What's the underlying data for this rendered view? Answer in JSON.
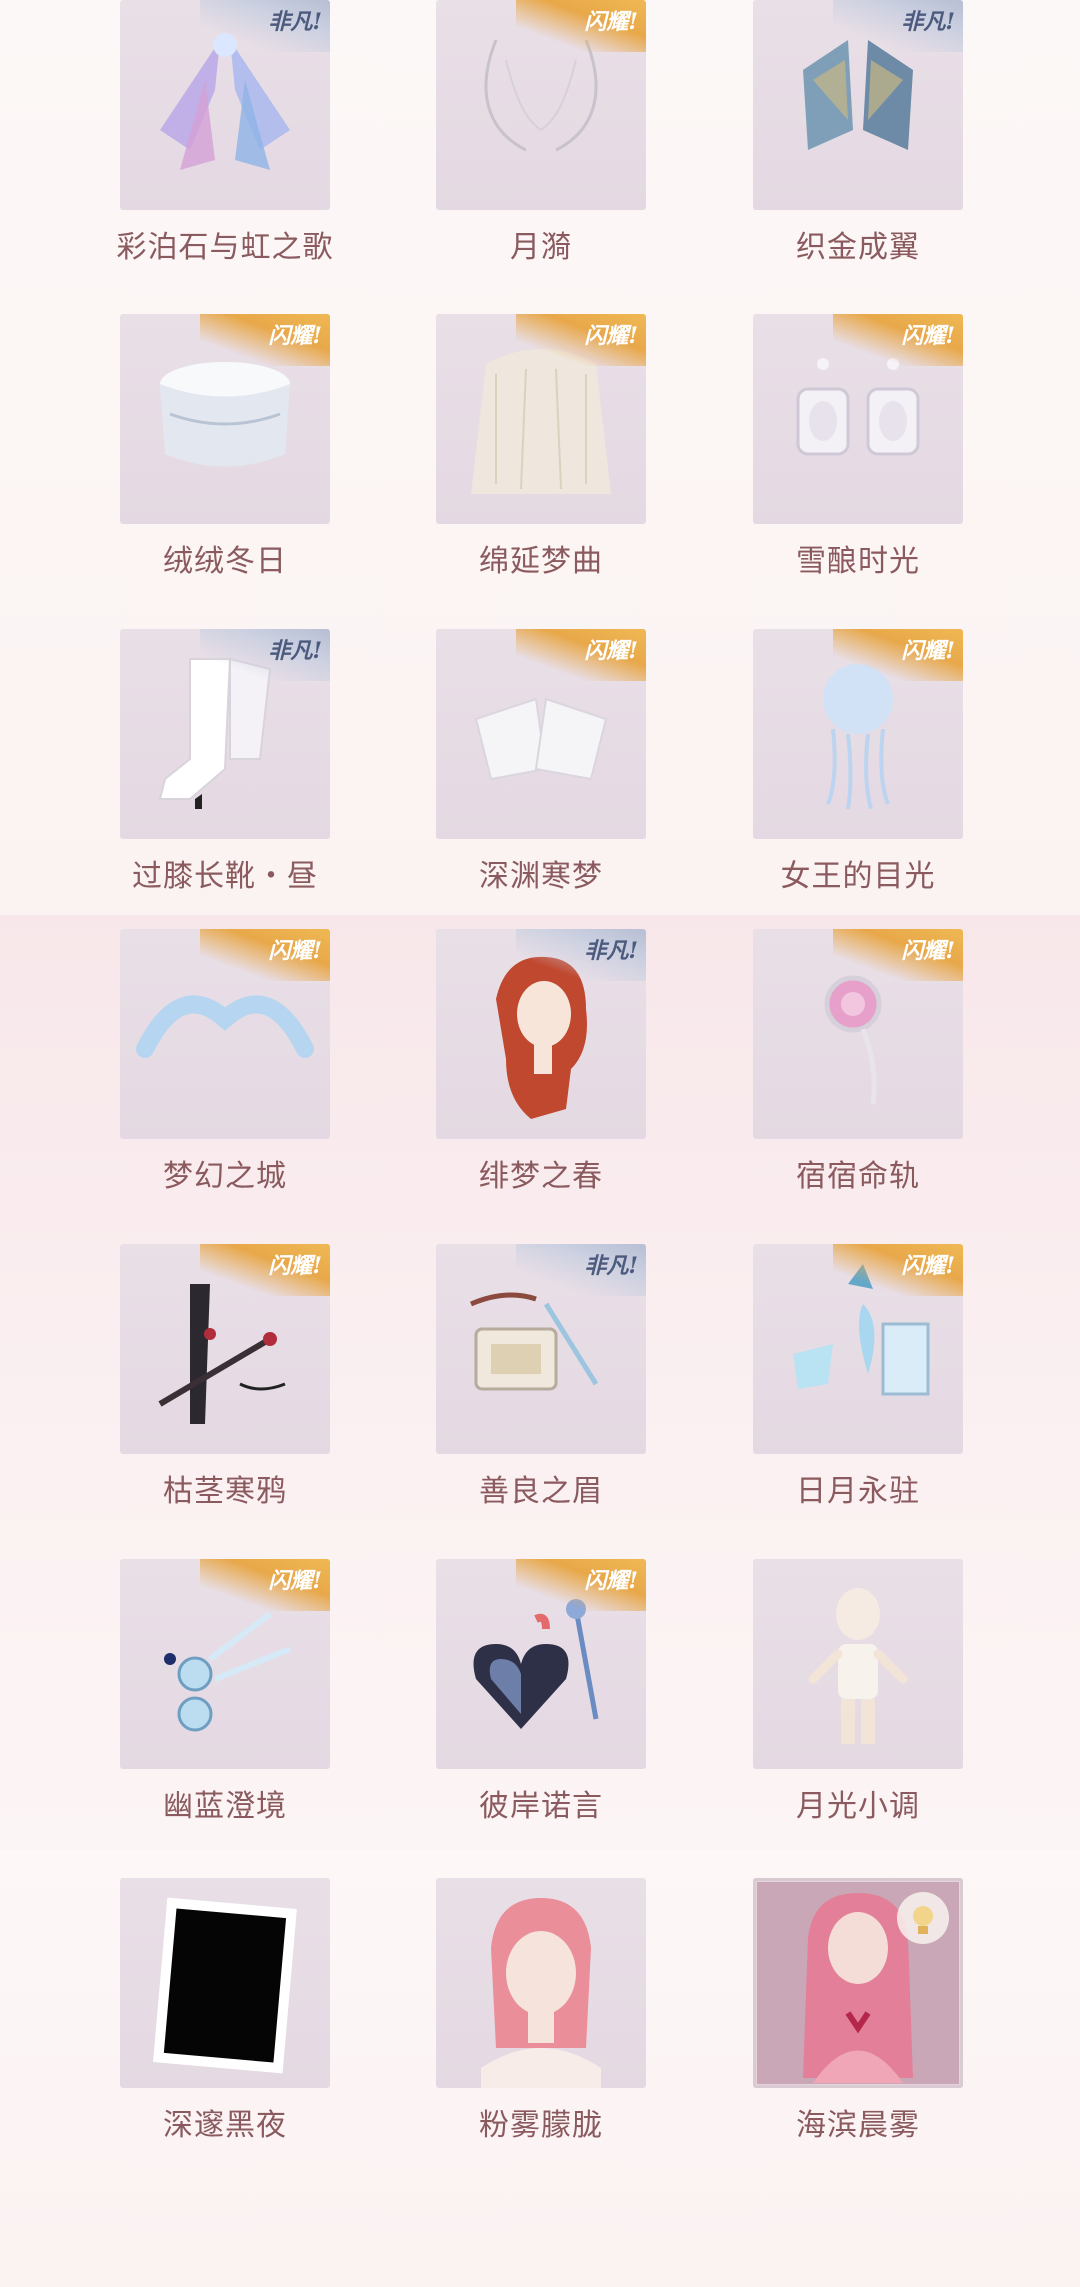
{
  "items": [
    {
      "name": "彩泊石与虹之歌",
      "badge": "非凡!",
      "badge_type": "silver",
      "icon": "crystal-wings-icon"
    },
    {
      "name": "月漪",
      "badge": "闪耀!",
      "badge_type": "gold",
      "icon": "sketch-wings-icon"
    },
    {
      "name": "织金成翼",
      "badge": "非凡!",
      "badge_type": "silver",
      "icon": "fabric-wings-icon"
    },
    {
      "name": "绒绒冬日",
      "badge": "闪耀!",
      "badge_type": "gold",
      "icon": "fur-hat-icon"
    },
    {
      "name": "绵延梦曲",
      "badge": "闪耀!",
      "badge_type": "gold",
      "icon": "veil-icon"
    },
    {
      "name": "雪酿时光",
      "badge": "闪耀!",
      "badge_type": "gold",
      "icon": "earrings-icon"
    },
    {
      "name": "过膝长靴・昼",
      "badge": "非凡!",
      "badge_type": "silver",
      "icon": "boots-icon"
    },
    {
      "name": "深渊寒梦",
      "badge": "闪耀!",
      "badge_type": "gold",
      "icon": "socks-icon"
    },
    {
      "name": "女王的目光",
      "badge": "闪耀!",
      "badge_type": "gold",
      "icon": "jellyfish-icon"
    },
    {
      "name": "梦幻之城",
      "badge": "闪耀!",
      "badge_type": "gold",
      "icon": "aura-icon"
    },
    {
      "name": "绯梦之春",
      "badge": "非凡!",
      "badge_type": "silver",
      "icon": "red-hair-icon"
    },
    {
      "name": "宿宿命轨",
      "badge": "闪耀!",
      "badge_type": "gold",
      "icon": "pink-gem-icon"
    },
    {
      "name": "枯茎寒鸦",
      "badge": "闪耀!",
      "badge_type": "gold",
      "icon": "dark-staff-icon"
    },
    {
      "name": "善良之眉",
      "badge": "非凡!",
      "badge_type": "silver",
      "icon": "eyebrow-kit-icon"
    },
    {
      "name": "日月永驻",
      "badge": "闪耀!",
      "badge_type": "gold",
      "icon": "perfume-set-icon"
    },
    {
      "name": "幽蓝澄境",
      "badge": "闪耀!",
      "badge_type": "gold",
      "icon": "blue-earrings-icon"
    },
    {
      "name": "彼岸诺言",
      "badge": "闪耀!",
      "badge_type": "gold",
      "icon": "heart-compact-icon"
    },
    {
      "name": "月光小调",
      "badge": "",
      "badge_type": "",
      "icon": "doll-body-icon"
    },
    {
      "name": "深邃黑夜",
      "badge": "",
      "badge_type": "",
      "icon": "black-frame-icon"
    },
    {
      "name": "粉雾朦胧",
      "badge": "",
      "badge_type": "",
      "icon": "pink-hair-face-icon"
    },
    {
      "name": "海滨晨雾",
      "badge": "",
      "badge_type": "",
      "icon": "photo-portrait-icon"
    }
  ]
}
